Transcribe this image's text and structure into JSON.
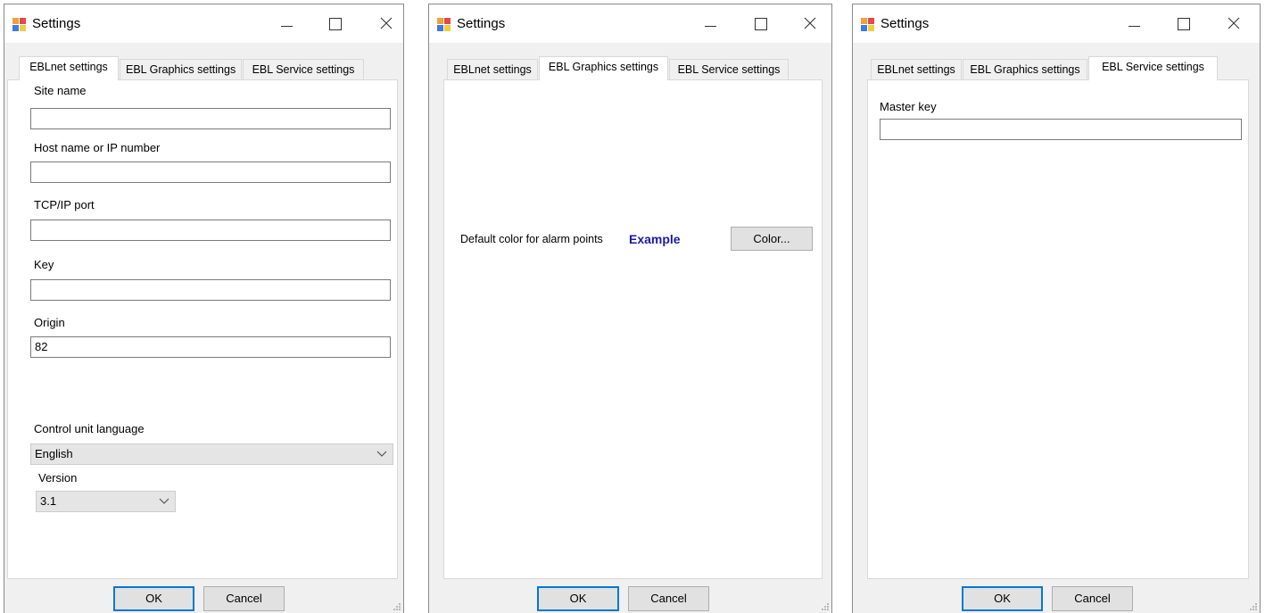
{
  "window_title": "Settings",
  "tabs": [
    "EBLnet settings",
    "EBL Graphics settings",
    "EBL Service settings"
  ],
  "buttons": {
    "ok": "OK",
    "cancel": "Cancel"
  },
  "eblnet": {
    "site_name_label": "Site name",
    "site_name_value": "",
    "host_label": "Host name or IP number",
    "host_value": "",
    "port_label": "TCP/IP port",
    "port_value": "",
    "key_label": "Key",
    "key_value": "",
    "origin_label": "Origin",
    "origin_value": "82",
    "language_label": "Control unit language",
    "language_value": "English",
    "version_label": "Version",
    "version_value": "3.1"
  },
  "graphics": {
    "default_color_label": "Default color for alarm points",
    "example_text": "Example",
    "example_color": "#1a1aa8",
    "color_button": "Color..."
  },
  "service": {
    "master_key_label": "Master key",
    "master_key_value": ""
  },
  "accent_color": "#0078d7"
}
